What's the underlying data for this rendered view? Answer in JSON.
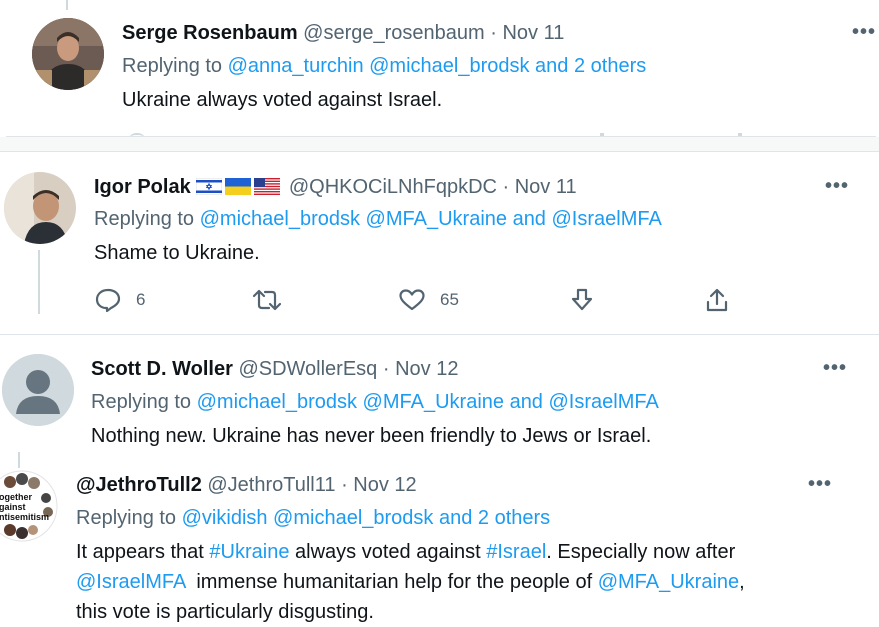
{
  "tweets": [
    {
      "name": "Serge Rosenbaum",
      "handle": "@serge_rosenbaum",
      "date": "· Nov 11",
      "replying_prefix": "Replying to ",
      "replying_links": "@anna_turchin @michael_brodsk and 2 others",
      "text": "Ukraine always voted against Israel."
    },
    {
      "name": "Igor Polak",
      "handle": "@QHKOCiLNhFqpkDC",
      "date": "· Nov 11",
      "flags": [
        "israel-flag-icon",
        "ukraine-flag-icon",
        "us-flag-icon"
      ],
      "replying_prefix": "Replying to ",
      "replying_links": "@michael_brodsk @MFA_Ukraine and @IsraelMFA",
      "text": "Shame to Ukraine.",
      "replies": "6",
      "likes": "65"
    },
    {
      "name": "Scott D. Woller",
      "handle": "@SDWollerEsq",
      "date": "· Nov 12",
      "replying_prefix": "Replying to ",
      "replying_links": "@michael_brodsk @MFA_Ukraine and @IsraelMFA",
      "text": "Nothing new. Ukraine has never been friendly to Jews or Israel."
    },
    {
      "name": "@JethroTull2",
      "handle": "@JethroTull11",
      "date": "· Nov 12",
      "avatar_text": "ogether\ngainst\nntisemitism",
      "replying_prefix": "Replying to ",
      "replying_links": "@vikidish @michael_brodsk and 2 others",
      "text_parts": {
        "p1": "It appears that ",
        "tag1": "#Ukraine",
        "p2": " always voted against ",
        "tag2": "#Israel",
        "p3": ". Especially now after",
        "mention1": "@IsraelMFA",
        "p4": "  immense humanitarian help for the people of ",
        "mention2": "@MFA_Ukraine",
        "p5": ",",
        "p6": "this vote is particularly disgusting."
      }
    }
  ],
  "more_label": "•••",
  "colors": {
    "link": "#1d9bf0",
    "muted": "#536471",
    "text": "#0f1419"
  }
}
